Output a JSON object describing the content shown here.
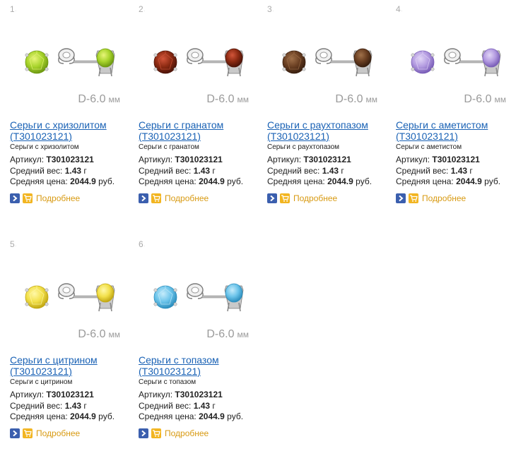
{
  "products": [
    {
      "num": "1.",
      "title_line1": "Серьги с хризолитом",
      "title_line2": "(Т301023121)",
      "desc": "Серьги с хризолитом",
      "article_label": "Артикул:",
      "article_value": "Т301023121",
      "weight_label": "Средний вес:",
      "weight_value": "1.43",
      "weight_unit": "г",
      "price_label": "Средняя цена:",
      "price_value": "2044.9",
      "price_unit": "руб.",
      "size_text": "D-6.0",
      "size_unit": "мм",
      "more_label": "Подробнее",
      "gem_color": "#a8d42c",
      "gem_highlight": "#e8f57a",
      "gem_dark": "#6f9a12"
    },
    {
      "num": "2.",
      "title_line1": "Серьги с гранатом",
      "title_line2": "(Т301023121)",
      "desc": "Серьги с гранатом",
      "article_label": "Артикул:",
      "article_value": "Т301023121",
      "weight_label": "Средний вес:",
      "weight_value": "1.43",
      "weight_unit": "г",
      "price_label": "Средняя цена:",
      "price_value": "2044.9",
      "price_unit": "руб.",
      "size_text": "D-6.0",
      "size_unit": "мм",
      "more_label": "Подробнее",
      "gem_color": "#8c2a12",
      "gem_highlight": "#d2553a",
      "gem_dark": "#4e1408"
    },
    {
      "num": "3.",
      "title_line1": "Серьги с раухтопазом",
      "title_line2": "(Т301023121)",
      "desc": "Серьги с раухтопазом",
      "article_label": "Артикул:",
      "article_value": "Т301023121",
      "weight_label": "Средний вес:",
      "weight_value": "1.43",
      "weight_unit": "г",
      "price_label": "Средняя цена:",
      "price_value": "2044.9",
      "price_unit": "руб.",
      "size_text": "D-6.0",
      "size_unit": "мм",
      "more_label": "Подробнее",
      "gem_color": "#6a3f22",
      "gem_highlight": "#a0714a",
      "gem_dark": "#3a2010"
    },
    {
      "num": "4.",
      "title_line1": "Серьги с аметистом",
      "title_line2": "(Т301023121)",
      "desc": "Серьги с аметистом",
      "article_label": "Артикул:",
      "article_value": "Т301023121",
      "weight_label": "Средний вес:",
      "weight_value": "1.43",
      "weight_unit": "г",
      "price_label": "Средняя цена:",
      "price_value": "2044.9",
      "price_unit": "руб.",
      "size_text": "D-6.0",
      "size_unit": "мм",
      "more_label": "Подробнее",
      "gem_color": "#b39be0",
      "gem_highlight": "#e2d6f7",
      "gem_dark": "#7a5eb8"
    },
    {
      "num": "5.",
      "title_line1": "Серьги с цитрином",
      "title_line2": "(Т301023121)",
      "desc": "Серьги с цитрином",
      "article_label": "Артикул:",
      "article_value": "Т301023121",
      "weight_label": "Средний вес:",
      "weight_value": "1.43",
      "weight_unit": "г",
      "price_label": "Средняя цена:",
      "price_value": "2044.9",
      "price_unit": "руб.",
      "size_text": "D-6.0",
      "size_unit": "мм",
      "more_label": "Подробнее",
      "gem_color": "#f2e04a",
      "gem_highlight": "#fff8a8",
      "gem_dark": "#c2a814"
    },
    {
      "num": "6.",
      "title_line1": "Серьги с топазом",
      "title_line2": "(Т301023121)",
      "desc": "Серьги с топазом",
      "article_label": "Артикул:",
      "article_value": "Т301023121",
      "weight_label": "Средний вес:",
      "weight_value": "1.43",
      "weight_unit": "г",
      "price_label": "Средняя цена:",
      "price_value": "2044.9",
      "price_unit": "руб.",
      "size_text": "D-6.0",
      "size_unit": "мм",
      "more_label": "Подробнее",
      "gem_color": "#6cc4ea",
      "gem_highlight": "#c6ecfb",
      "gem_dark": "#2e8fbe"
    }
  ]
}
